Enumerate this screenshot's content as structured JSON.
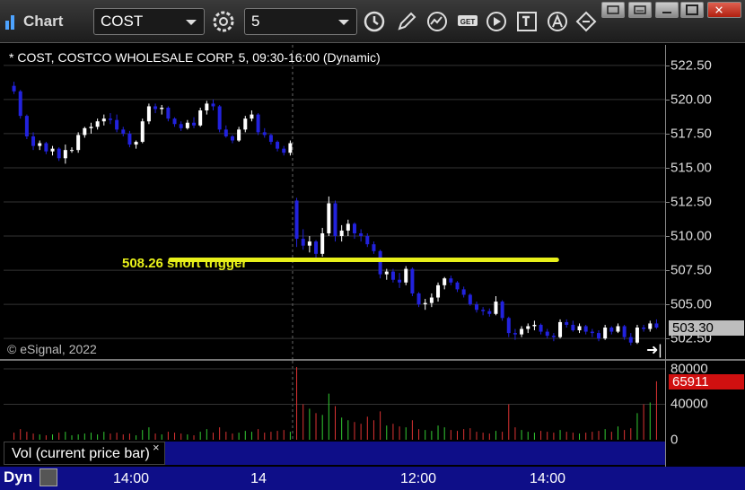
{
  "toolbar": {
    "app_title": "Chart",
    "symbol": "COST",
    "interval": "5",
    "icons": [
      "settings-gear-icon",
      "clock-icon",
      "pencil-draw-icon",
      "study-icon",
      "get-data-icon",
      "play-icon",
      "text-tool-icon",
      "alert-icon",
      "cursor-link-icon"
    ],
    "window_buttons": [
      "restore",
      "minimize",
      "maximize",
      "close"
    ]
  },
  "chart": {
    "header": "* COST, COSTCO WHOLESALE CORP, 5, 09:30-16:00 (Dynamic)",
    "copyright": "© eSignal, 2022",
    "annotation": "508.26 short trigger",
    "trigger_price": 508.26,
    "annotation_color": "#e8f01a",
    "last_price": "503.30",
    "price_ticks": [
      "522.50",
      "520.00",
      "517.50",
      "515.00",
      "512.50",
      "510.00",
      "507.50",
      "505.00",
      "502.50"
    ],
    "scroll_end": "➜|"
  },
  "volume": {
    "legend": "Vol (current price bar)",
    "close_glyph": "×",
    "last_volume": "65911",
    "ticks": [
      "80000",
      "40000",
      "0"
    ]
  },
  "time_axis": {
    "mode": "Dyn",
    "labels": [
      "14:00",
      "14",
      "12:00",
      "14:00"
    ]
  },
  "chart_data": {
    "type": "candlestick",
    "price_ylim": [
      501.0,
      524.0
    ],
    "volume_ylim": [
      0,
      85000
    ],
    "colors": {
      "up": "#ffffff",
      "down": "#2222dd",
      "vol_up": "#33cc33",
      "vol_down": "#dd3333"
    },
    "candles": [
      [
        521.0,
        521.3,
        520.4,
        520.6
      ],
      [
        520.6,
        520.7,
        518.6,
        518.8
      ],
      [
        518.8,
        518.9,
        517.1,
        517.3
      ],
      [
        517.3,
        517.6,
        516.3,
        516.6
      ],
      [
        516.6,
        517.0,
        516.3,
        516.8
      ],
      [
        516.8,
        516.9,
        516.0,
        516.2
      ],
      [
        516.2,
        516.6,
        515.9,
        516.4
      ],
      [
        516.4,
        516.5,
        515.5,
        515.7
      ],
      [
        515.7,
        516.7,
        515.3,
        516.3
      ],
      [
        516.3,
        516.5,
        516.1,
        516.3
      ],
      [
        516.3,
        517.6,
        516.1,
        517.4
      ],
      [
        517.4,
        518.0,
        517.2,
        517.9
      ],
      [
        517.9,
        518.3,
        517.5,
        518.0
      ],
      [
        518.0,
        518.6,
        517.8,
        518.4
      ],
      [
        518.4,
        518.9,
        518.1,
        518.6
      ],
      [
        518.6,
        519.0,
        518.2,
        518.5
      ],
      [
        518.5,
        518.9,
        517.6,
        517.8
      ],
      [
        517.8,
        518.0,
        517.3,
        517.5
      ],
      [
        517.5,
        517.7,
        516.5,
        516.7
      ],
      [
        516.7,
        517.0,
        516.4,
        516.9
      ],
      [
        516.9,
        518.6,
        516.8,
        518.4
      ],
      [
        518.4,
        519.7,
        518.2,
        519.5
      ],
      [
        519.5,
        519.7,
        519.0,
        519.3
      ],
      [
        519.3,
        519.6,
        518.9,
        519.4
      ],
      [
        519.4,
        519.5,
        518.4,
        518.6
      ],
      [
        518.6,
        518.7,
        518.0,
        518.2
      ],
      [
        518.2,
        518.4,
        517.7,
        517.9
      ],
      [
        517.9,
        518.5,
        517.8,
        518.3
      ],
      [
        518.3,
        518.7,
        517.9,
        518.1
      ],
      [
        518.1,
        519.4,
        518.0,
        519.2
      ],
      [
        519.2,
        519.9,
        518.9,
        519.7
      ],
      [
        519.7,
        520.0,
        519.2,
        519.5
      ],
      [
        519.5,
        519.6,
        517.6,
        517.8
      ],
      [
        517.8,
        518.1,
        517.2,
        517.3
      ],
      [
        517.3,
        517.4,
        516.8,
        517.0
      ],
      [
        517.0,
        518.0,
        516.9,
        517.8
      ],
      [
        517.8,
        518.8,
        517.6,
        518.6
      ],
      [
        518.6,
        519.2,
        518.4,
        518.9
      ],
      [
        518.9,
        519.0,
        517.4,
        517.6
      ],
      [
        517.6,
        517.9,
        517.2,
        517.4
      ],
      [
        517.4,
        517.5,
        516.7,
        516.9
      ],
      [
        516.9,
        517.0,
        516.2,
        516.4
      ],
      [
        516.4,
        516.6,
        515.9,
        516.1
      ],
      [
        516.1,
        517.0,
        515.9,
        516.8
      ],
      [
        512.6,
        512.8,
        509.2,
        509.8
      ],
      [
        509.8,
        510.5,
        509.0,
        509.3
      ],
      [
        509.3,
        510.0,
        508.8,
        509.6
      ],
      [
        509.6,
        509.7,
        508.4,
        508.7
      ],
      [
        508.7,
        510.6,
        508.5,
        510.2
      ],
      [
        510.2,
        512.9,
        510.0,
        512.4
      ],
      [
        512.4,
        512.6,
        509.6,
        510.0
      ],
      [
        510.0,
        510.8,
        509.6,
        510.4
      ],
      [
        510.4,
        511.2,
        510.0,
        510.9
      ],
      [
        510.9,
        511.0,
        509.8,
        510.2
      ],
      [
        510.2,
        510.5,
        509.6,
        510.0
      ],
      [
        510.0,
        510.2,
        509.2,
        509.4
      ],
      [
        509.4,
        509.6,
        508.7,
        508.9
      ],
      [
        508.9,
        509.0,
        506.9,
        507.2
      ],
      [
        507.2,
        507.6,
        506.8,
        507.4
      ],
      [
        507.4,
        507.6,
        506.6,
        506.8
      ],
      [
        506.8,
        507.3,
        506.2,
        506.6
      ],
      [
        506.6,
        507.8,
        506.4,
        507.6
      ],
      [
        507.6,
        507.7,
        505.6,
        505.8
      ],
      [
        505.8,
        505.9,
        504.8,
        505.0
      ],
      [
        505.0,
        505.4,
        504.6,
        505.1
      ],
      [
        505.1,
        505.8,
        504.8,
        505.5
      ],
      [
        505.5,
        506.6,
        505.2,
        506.4
      ],
      [
        506.4,
        507.0,
        506.1,
        506.9
      ],
      [
        506.9,
        507.1,
        506.4,
        506.6
      ],
      [
        506.6,
        506.7,
        505.9,
        506.1
      ],
      [
        506.1,
        506.3,
        505.5,
        505.7
      ],
      [
        505.7,
        505.8,
        504.9,
        505.0
      ],
      [
        505.0,
        505.2,
        504.4,
        504.6
      ],
      [
        504.6,
        504.8,
        504.2,
        504.5
      ],
      [
        504.5,
        504.7,
        504.1,
        504.3
      ],
      [
        504.3,
        505.6,
        504.2,
        505.2
      ],
      [
        505.2,
        505.3,
        503.8,
        504.0
      ],
      [
        504.0,
        504.1,
        502.6,
        502.9
      ],
      [
        502.9,
        503.2,
        502.4,
        502.8
      ],
      [
        502.8,
        503.4,
        502.6,
        503.2
      ],
      [
        503.2,
        503.6,
        502.9,
        503.4
      ],
      [
        503.4,
        503.8,
        503.1,
        503.5
      ],
      [
        503.5,
        503.6,
        502.8,
        503.0
      ],
      [
        503.0,
        503.2,
        502.5,
        502.7
      ],
      [
        502.7,
        502.9,
        502.3,
        502.6
      ],
      [
        502.6,
        503.9,
        502.5,
        503.7
      ],
      [
        503.7,
        503.9,
        503.3,
        503.5
      ],
      [
        503.5,
        503.8,
        503.0,
        503.1
      ],
      [
        503.1,
        503.6,
        502.9,
        503.4
      ],
      [
        503.4,
        503.5,
        502.8,
        503.0
      ],
      [
        503.0,
        503.2,
        502.6,
        502.9
      ],
      [
        502.9,
        503.1,
        502.3,
        502.5
      ],
      [
        502.5,
        503.5,
        502.4,
        503.3
      ],
      [
        503.3,
        503.4,
        502.8,
        503.0
      ],
      [
        503.0,
        503.6,
        502.9,
        503.4
      ],
      [
        503.4,
        503.5,
        502.4,
        502.6
      ],
      [
        502.6,
        502.9,
        502.0,
        502.2
      ],
      [
        502.2,
        503.5,
        502.1,
        503.3
      ],
      [
        503.3,
        503.5,
        503.0,
        503.2
      ],
      [
        503.2,
        503.8,
        503.0,
        503.6
      ],
      [
        503.6,
        503.9,
        503.2,
        503.3
      ]
    ],
    "volumes": [
      8000,
      12000,
      9000,
      7000,
      6000,
      5000,
      6000,
      8000,
      9000,
      5000,
      6000,
      7000,
      8000,
      6000,
      9000,
      7000,
      8000,
      6000,
      7000,
      5000,
      11000,
      14000,
      7000,
      6000,
      9000,
      8000,
      7000,
      6000,
      5000,
      9000,
      12000,
      8000,
      14000,
      9000,
      7000,
      8000,
      10000,
      9000,
      12000,
      8000,
      9000,
      10000,
      11000,
      9000,
      82000,
      40000,
      35000,
      30000,
      28000,
      52000,
      38000,
      25000,
      22000,
      20000,
      18000,
      26000,
      22000,
      32000,
      16000,
      18000,
      15000,
      14000,
      22000,
      12000,
      11000,
      10000,
      16000,
      14000,
      11000,
      10000,
      12000,
      13000,
      9000,
      8000,
      7000,
      10000,
      9000,
      40000,
      14000,
      11000,
      9000,
      8000,
      10000,
      9000,
      8000,
      11000,
      9000,
      8000,
      7000,
      8000,
      9000,
      10000,
      12000,
      9000,
      15000,
      11000,
      13000,
      30000,
      40000,
      42000,
      65911
    ],
    "trigger_line": {
      "price": 508.26,
      "from_bar": 38,
      "to_bar": 74
    },
    "session_break_bar": 44
  }
}
